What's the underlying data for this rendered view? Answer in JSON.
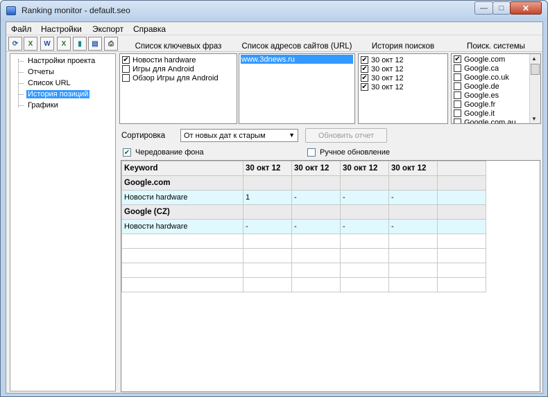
{
  "window": {
    "title": "Ranking monitor - default.seo",
    "close_glyph": "✕",
    "max_glyph": "□",
    "min_glyph": "—"
  },
  "menu": [
    "Файл",
    "Настройки",
    "Экспорт",
    "Справка"
  ],
  "toolbar_icons": [
    "refresh-icon",
    "excel-icon",
    "word-icon",
    "excel-export-icon",
    "book-icon",
    "web-icon",
    "print-icon"
  ],
  "tree": {
    "items": [
      {
        "label": "Настройки проекта",
        "selected": false
      },
      {
        "label": "Отчеты",
        "selected": false
      },
      {
        "label": "Список URL",
        "selected": false
      },
      {
        "label": "История позиций",
        "selected": true
      },
      {
        "label": "Графики",
        "selected": false
      }
    ]
  },
  "keywords": {
    "title": "Список ключевых фраз",
    "items": [
      {
        "label": "Новости hardware",
        "checked": true
      },
      {
        "label": "Игры для Android",
        "checked": false
      },
      {
        "label": "Обзор Игры для Android",
        "checked": false
      }
    ]
  },
  "urls": {
    "title": "Список адресов сайтов (URL)",
    "items": [
      "www.3dnews.ru"
    ]
  },
  "history": {
    "title": "История поисков",
    "items": [
      {
        "label": "30 окт 12",
        "checked": true
      },
      {
        "label": "30 окт 12",
        "checked": true
      },
      {
        "label": "30 окт 12",
        "checked": true
      },
      {
        "label": "30 окт 12",
        "checked": true
      }
    ]
  },
  "engines": {
    "title": "Поиск. системы",
    "items": [
      {
        "label": "Google.com",
        "checked": true
      },
      {
        "label": "Google.ca",
        "checked": false
      },
      {
        "label": "Google.co.uk",
        "checked": false
      },
      {
        "label": "Google.de",
        "checked": false
      },
      {
        "label": "Google.es",
        "checked": false
      },
      {
        "label": "Google.fr",
        "checked": false
      },
      {
        "label": "Google.it",
        "checked": false
      },
      {
        "label": "Google.com.au",
        "checked": false
      }
    ]
  },
  "sort": {
    "label": "Сортировка",
    "value": "От новых дат к старым",
    "update_button": "Обновить отчет"
  },
  "options": {
    "alternate_bg": {
      "label": "Чередование фона",
      "checked": true
    },
    "manual_update": {
      "label": "Ручное обновление",
      "checked": false
    }
  },
  "grid": {
    "headers": [
      "Keyword",
      "30 окт 12",
      "30 окт 12",
      "30 окт 12",
      "30 окт 12",
      ""
    ],
    "rows": [
      {
        "type": "group",
        "cells": [
          "Google.com",
          "",
          "",
          "",
          "",
          ""
        ]
      },
      {
        "type": "data",
        "cells": [
          "Новости hardware",
          "1",
          "-",
          "-",
          "-",
          ""
        ]
      },
      {
        "type": "group",
        "cells": [
          "Google (CZ)",
          "",
          "",
          "",
          "",
          ""
        ]
      },
      {
        "type": "data",
        "cells": [
          "Новости hardware",
          "-",
          "-",
          "-",
          "-",
          ""
        ]
      },
      {
        "type": "empty",
        "cells": [
          "",
          "",
          "",
          "",
          "",
          ""
        ]
      },
      {
        "type": "empty",
        "cells": [
          "",
          "",
          "",
          "",
          "",
          ""
        ]
      },
      {
        "type": "empty",
        "cells": [
          "",
          "",
          "",
          "",
          "",
          ""
        ]
      },
      {
        "type": "empty",
        "cells": [
          "",
          "",
          "",
          "",
          "",
          ""
        ]
      }
    ]
  }
}
